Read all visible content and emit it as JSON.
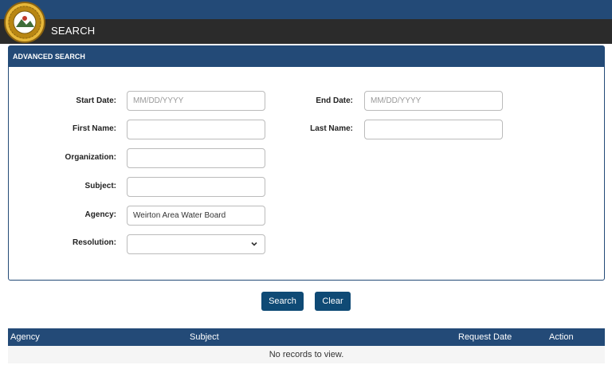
{
  "header": {
    "title": "SEARCH",
    "logo_icon": "seal-icon"
  },
  "panel": {
    "title": "ADVANCED SEARCH"
  },
  "form": {
    "start_date": {
      "label": "Start Date:",
      "placeholder": "MM/DD/YYYY",
      "value": ""
    },
    "end_date": {
      "label": "End Date:",
      "placeholder": "MM/DD/YYYY",
      "value": ""
    },
    "first_name": {
      "label": "First Name:",
      "value": ""
    },
    "last_name": {
      "label": "Last Name:",
      "value": ""
    },
    "organization": {
      "label": "Organization:",
      "value": ""
    },
    "subject": {
      "label": "Subject:",
      "value": ""
    },
    "agency": {
      "label": "Agency:",
      "value": "Weirton Area Water Board"
    },
    "resolution": {
      "label": "Resolution:",
      "value": ""
    }
  },
  "buttons": {
    "search": "Search",
    "clear": "Clear"
  },
  "table": {
    "columns": [
      "Agency",
      "Subject",
      "Request Date",
      "Action"
    ],
    "empty_message": "No records to view."
  },
  "colors": {
    "header_blue": "#234a77",
    "title_bar": "#2b2b2b",
    "button_blue": "#0f4a75"
  }
}
